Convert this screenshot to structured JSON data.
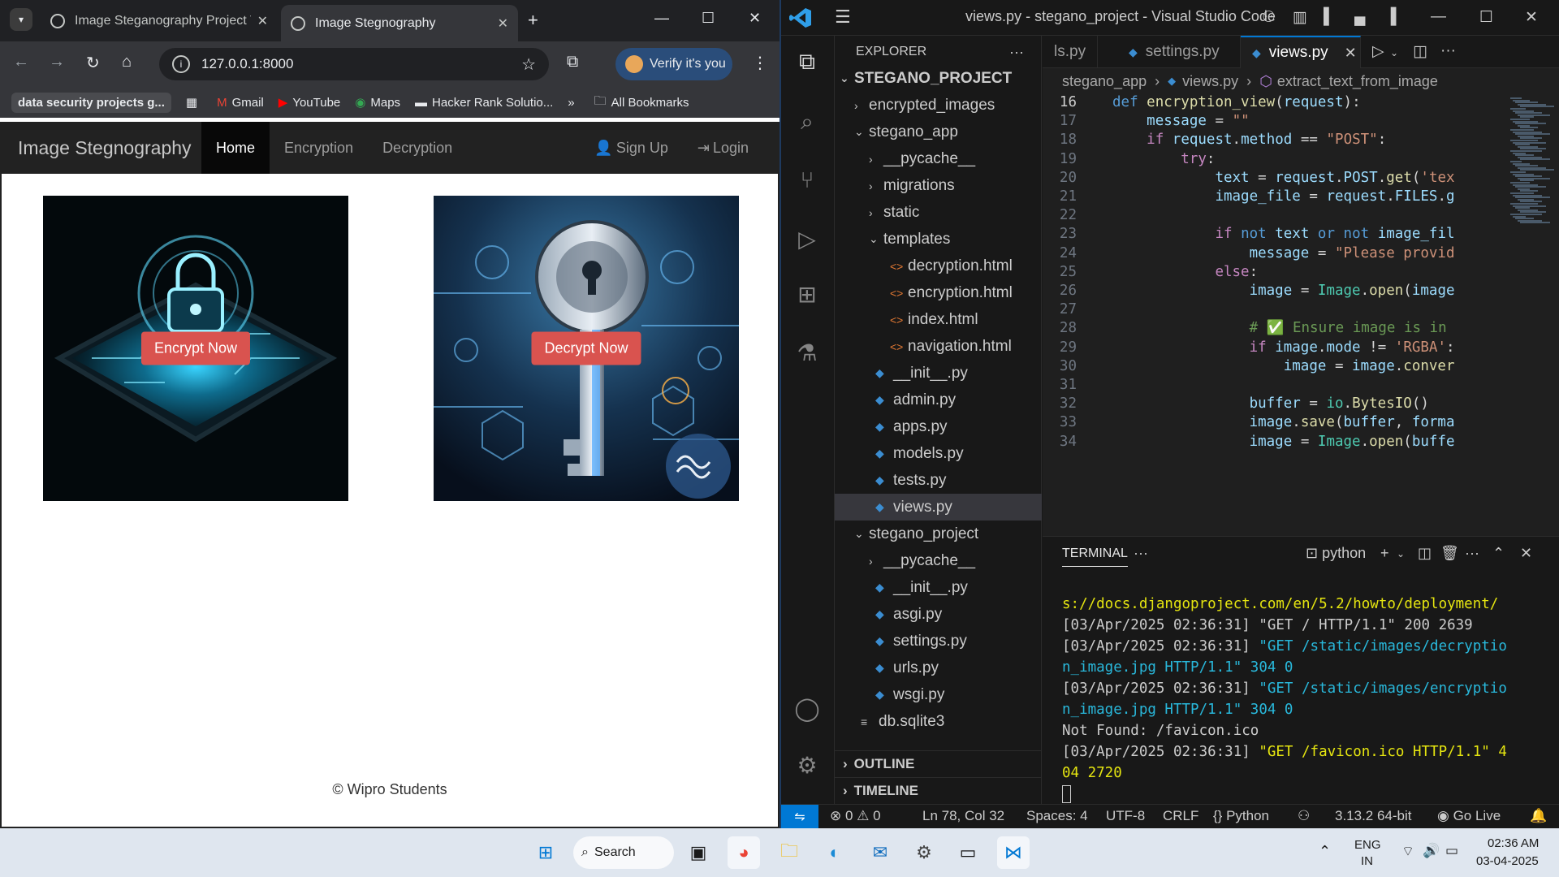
{
  "browser": {
    "tabs": [
      {
        "title": "Image Steganography Project V"
      },
      {
        "title": "Image Stegnography"
      }
    ],
    "address": "127.0.0.1:8000",
    "profile_label": "Verify it's you",
    "bookmarks": [
      {
        "label": "data security projects g...",
        "icon": "bookmark-tile"
      },
      {
        "label": "Gmail",
        "icon": "gmail-icon"
      },
      {
        "label": "YouTube",
        "icon": "youtube-icon"
      },
      {
        "label": "Maps",
        "icon": "maps-icon"
      },
      {
        "label": "Hacker Rank Solutio...",
        "icon": "hackerrank-icon"
      }
    ],
    "all_bookmarks": "All Bookmarks"
  },
  "site": {
    "brand": "Image Stegnography",
    "nav": [
      "Home",
      "Encryption",
      "Decryption"
    ],
    "nav_right": [
      "Sign Up",
      "Login"
    ],
    "cards": [
      {
        "button": "Encrypt Now"
      },
      {
        "button": "Decrypt Now"
      }
    ],
    "footer": "© Wipro Students"
  },
  "vscode": {
    "window_title": "views.py - stegano_project - Visual Studio Code",
    "explorer_title": "EXPLORER",
    "project": "STEGANO_PROJECT",
    "tree": [
      {
        "label": "encrypted_images",
        "type": "folder",
        "open": false,
        "depth": 1
      },
      {
        "label": "stegano_app",
        "type": "folder",
        "open": true,
        "depth": 1
      },
      {
        "label": "__pycache__",
        "type": "folder",
        "open": false,
        "depth": 2
      },
      {
        "label": "migrations",
        "type": "folder",
        "open": false,
        "depth": 2
      },
      {
        "label": "static",
        "type": "folder",
        "open": false,
        "depth": 2
      },
      {
        "label": "templates",
        "type": "folder",
        "open": true,
        "depth": 2
      },
      {
        "label": "decryption.html",
        "type": "html",
        "depth": 3
      },
      {
        "label": "encryption.html",
        "type": "html",
        "depth": 3
      },
      {
        "label": "index.html",
        "type": "html",
        "depth": 3
      },
      {
        "label": "navigation.html",
        "type": "html",
        "depth": 3
      },
      {
        "label": "__init__.py",
        "type": "py",
        "depth": 2
      },
      {
        "label": "admin.py",
        "type": "py",
        "depth": 2
      },
      {
        "label": "apps.py",
        "type": "py",
        "depth": 2
      },
      {
        "label": "models.py",
        "type": "py",
        "depth": 2
      },
      {
        "label": "tests.py",
        "type": "py",
        "depth": 2
      },
      {
        "label": "views.py",
        "type": "py",
        "depth": 2,
        "selected": true
      },
      {
        "label": "stegano_project",
        "type": "folder",
        "open": true,
        "depth": 1
      },
      {
        "label": "__pycache__",
        "type": "folder",
        "open": false,
        "depth": 2
      },
      {
        "label": "__init__.py",
        "type": "py",
        "depth": 2
      },
      {
        "label": "asgi.py",
        "type": "py",
        "depth": 2
      },
      {
        "label": "settings.py",
        "type": "py",
        "depth": 2
      },
      {
        "label": "urls.py",
        "type": "py",
        "depth": 2
      },
      {
        "label": "wsgi.py",
        "type": "py",
        "depth": 2
      },
      {
        "label": "db.sqlite3",
        "type": "db",
        "depth": 1
      }
    ],
    "sections": [
      "OUTLINE",
      "TIMELINE"
    ],
    "editor_tabs": [
      "ls.py",
      "settings.py",
      "views.py"
    ],
    "breadcrumbs": [
      "stegano_app",
      "views.py",
      "extract_text_from_image"
    ],
    "code": [
      {
        "n": "16",
        "t": "def encryption_view(request):"
      },
      {
        "n": "17",
        "t": "    message = \"\""
      },
      {
        "n": "18",
        "t": "    if request.method == \"POST\":"
      },
      {
        "n": "19",
        "t": "        try:"
      },
      {
        "n": "20",
        "t": "            text = request.POST.get('tex"
      },
      {
        "n": "21",
        "t": "            image_file = request.FILES.g"
      },
      {
        "n": "22",
        "t": ""
      },
      {
        "n": "23",
        "t": "            if not text or not image_fil"
      },
      {
        "n": "24",
        "t": "                message = \"Please provid"
      },
      {
        "n": "25",
        "t": "            else:"
      },
      {
        "n": "26",
        "t": "                image = Image.open(image"
      },
      {
        "n": "27",
        "t": ""
      },
      {
        "n": "28",
        "t": "                # ✅ Ensure image is in"
      },
      {
        "n": "29",
        "t": "                if image.mode != 'RGBA':"
      },
      {
        "n": "30",
        "t": "                    image = image.conver"
      },
      {
        "n": "31",
        "t": ""
      },
      {
        "n": "32",
        "t": "                buffer = io.BytesIO()"
      },
      {
        "n": "33",
        "t": "                image.save(buffer, forma"
      },
      {
        "n": "34",
        "t": "                image = Image.open(buffe"
      }
    ],
    "panel_tab": "TERMINAL",
    "terminal_shell": "python",
    "terminal": [
      {
        "t": "s://docs.djangoproject.com/en/5.2/howto/deployment/",
        "c": "y"
      },
      {
        "t": "[03/Apr/2025 02:36:31] \"GET / HTTP/1.1\" 200 2639",
        "c": "n"
      },
      {
        "t": "[03/Apr/2025 02:36:31] \"GET /static/images/decryptio",
        "c": "b"
      },
      {
        "t": "n_image.jpg HTTP/1.1\" 304 0",
        "c": "b"
      },
      {
        "t": "[03/Apr/2025 02:36:31] \"GET /static/images/encryptio",
        "c": "b"
      },
      {
        "t": "n_image.jpg HTTP/1.1\" 304 0",
        "c": "b"
      },
      {
        "t": "Not Found: /favicon.ico",
        "c": "n"
      },
      {
        "t": "[03/Apr/2025 02:36:31] \"GET /favicon.ico HTTP/1.1\" 4",
        "c": "y"
      },
      {
        "t": "04 2720",
        "c": "y"
      }
    ],
    "status": {
      "problems": "⊗ 0 ⚠ 0",
      "position": "Ln 78, Col 32",
      "spaces": "Spaces: 4",
      "encoding": "UTF-8",
      "eol": "CRLF",
      "language": "{} Python",
      "interpreter": "3.13.2 64-bit",
      "golive": "Go Live"
    }
  },
  "taskbar": {
    "search": "Search",
    "lang1": "ENG",
    "lang2": "IN",
    "time": "02:36 AM",
    "date": "03-04-2025"
  },
  "colors": {
    "accent": "#0078d4",
    "button_red": "#d9534f",
    "navbar": "#222222"
  }
}
